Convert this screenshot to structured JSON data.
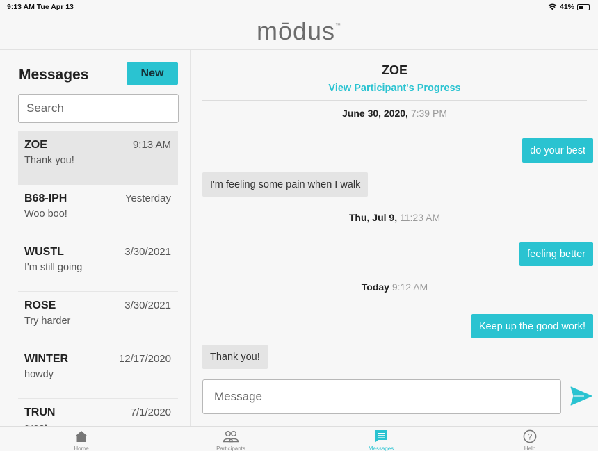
{
  "status_bar": {
    "time": "9:13 AM  Tue Apr 13",
    "battery": "41%",
    "battery_level": 0.41
  },
  "header": {
    "logo": "mōdus",
    "logo_tm": "™"
  },
  "messages_panel": {
    "title": "Messages",
    "new_button": "New",
    "search_placeholder": "Search",
    "conversations": [
      {
        "name": "ZOE",
        "time": "9:13 AM",
        "preview": "Thank you!",
        "active": true
      },
      {
        "name": "B68-IPH",
        "time": "Yesterday",
        "preview": "Woo boo!"
      },
      {
        "name": "WUSTL",
        "time": "3/30/2021",
        "preview": "I'm still going"
      },
      {
        "name": "ROSE",
        "time": "3/30/2021",
        "preview": "Try harder"
      },
      {
        "name": "WINTER",
        "time": "12/17/2020",
        "preview": "howdy"
      },
      {
        "name": "TRUN",
        "time": "7/1/2020",
        "preview": "great"
      }
    ]
  },
  "chat": {
    "participant": "ZOE",
    "progress_link": "View Participant's Progress",
    "thread": [
      {
        "kind": "date",
        "date": "June 30, 2020,",
        "time": " 7:39 PM"
      },
      {
        "kind": "out",
        "text": "do your best"
      },
      {
        "kind": "in",
        "text": "I'm feeling some pain when I walk"
      },
      {
        "kind": "date",
        "date": "Thu, Jul 9,",
        "time": " 11:23 AM"
      },
      {
        "kind": "out",
        "text": "feeling better"
      },
      {
        "kind": "date",
        "date": "Today",
        "time": " 9:12 AM"
      },
      {
        "kind": "out",
        "text": "Keep up the good work!"
      },
      {
        "kind": "in",
        "text": "Thank you!"
      }
    ],
    "composer_placeholder": "Message"
  },
  "tabs": [
    {
      "label": "Home",
      "icon": "home-icon"
    },
    {
      "label": "Participants",
      "icon": "participants-icon"
    },
    {
      "label": "Messages",
      "icon": "messages-icon",
      "active": true
    },
    {
      "label": "Help",
      "icon": "help-icon"
    }
  ],
  "colors": {
    "accent": "#2ac3d1",
    "panel_bg": "#f7f7f7",
    "active_row": "#e6e6e6",
    "incoming_bubble": "#e4e4e4"
  }
}
